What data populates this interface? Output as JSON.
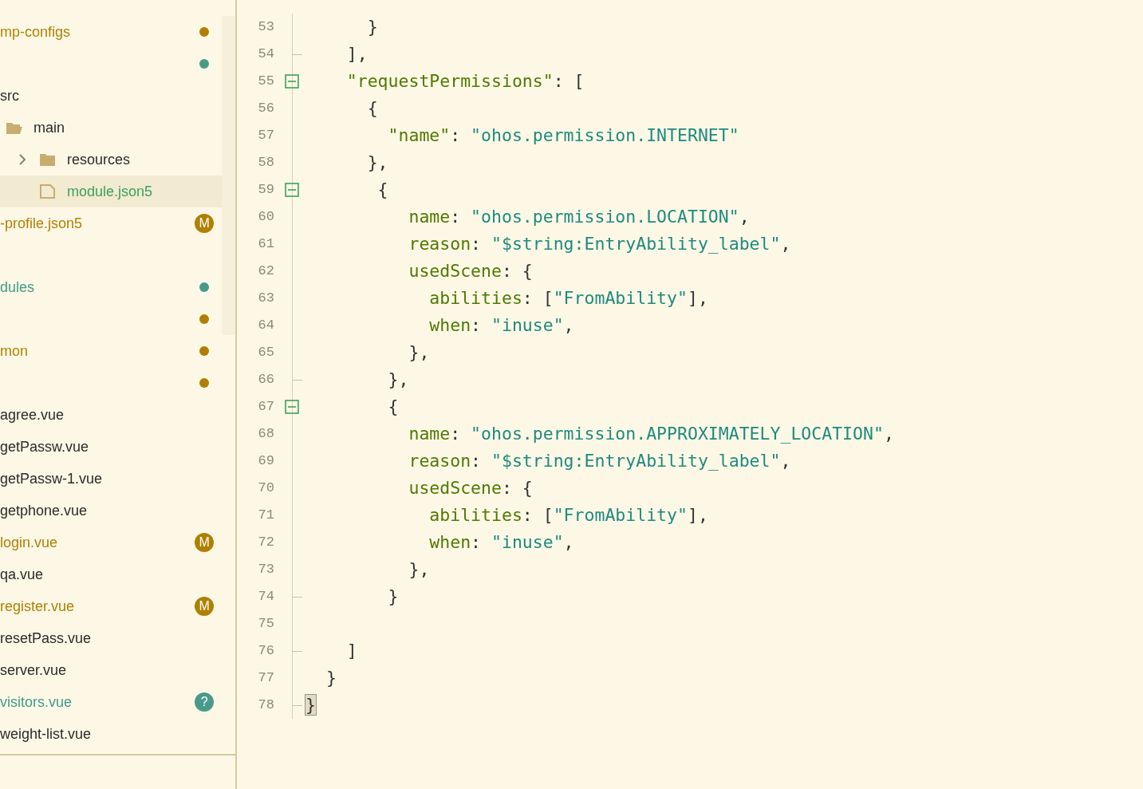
{
  "sidebar": {
    "items": [
      {
        "kind": "plain",
        "text": "mp-configs",
        "color": "#b07f00",
        "decoration": {
          "kind": "dot",
          "color": "#b07f00"
        }
      },
      {
        "kind": "plain",
        "decoration": {
          "kind": "dot",
          "color": "#4a9a8c"
        }
      },
      {
        "kind": "plain",
        "text": "src",
        "color": "#2b2b2b"
      },
      {
        "kind": "folder_open",
        "text": "main",
        "color": "#2b2b2b"
      },
      {
        "kind": "folder",
        "text": "resources",
        "color": "#2b2b2b",
        "expanded": false
      },
      {
        "kind": "file",
        "text": "module.json5",
        "color": "#3aa35a",
        "selected": true
      },
      {
        "kind": "plain",
        "text": "-profile.json5",
        "color": "#b07f00",
        "selected": false,
        "decoration": {
          "kind": "badge",
          "text": "M",
          "color": "#b07f00"
        }
      },
      {
        "kind": "spacer"
      },
      {
        "kind": "plain",
        "text": "dules",
        "color": "#3f9a8c",
        "decoration": {
          "kind": "dot",
          "color": "#4a9a8c"
        }
      },
      {
        "kind": "plain",
        "decoration": {
          "kind": "dot",
          "color": "#b07f00"
        }
      },
      {
        "kind": "plain",
        "text": "mon",
        "color": "#b07f00",
        "decoration": {
          "kind": "dot",
          "color": "#b07f00"
        }
      },
      {
        "kind": "plain",
        "decoration": {
          "kind": "dot",
          "color": "#b07f00"
        }
      },
      {
        "kind": "plain",
        "text": "agree.vue",
        "color": "#2b2b2b"
      },
      {
        "kind": "plain",
        "text": "getPassw.vue",
        "color": "#2b2b2b"
      },
      {
        "kind": "plain",
        "text": "getPassw-1.vue",
        "color": "#2b2b2b"
      },
      {
        "kind": "plain",
        "text": "getphone.vue",
        "color": "#2b2b2b"
      },
      {
        "kind": "plain",
        "text": "login.vue",
        "color": "#b07f00",
        "decoration": {
          "kind": "badge",
          "text": "M",
          "color": "#b07f00"
        }
      },
      {
        "kind": "plain",
        "text": "qa.vue",
        "color": "#2b2b2b"
      },
      {
        "kind": "plain",
        "text": "register.vue",
        "color": "#b07f00",
        "decoration": {
          "kind": "badge",
          "text": "M",
          "color": "#b07f00"
        }
      },
      {
        "kind": "plain",
        "text": "resetPass.vue",
        "color": "#2b2b2b"
      },
      {
        "kind": "plain",
        "text": "server.vue",
        "color": "#2b2b2b"
      },
      {
        "kind": "plain",
        "text": "visitors.vue",
        "color": "#3f9a8c",
        "decoration": {
          "kind": "badge",
          "text": "?",
          "color": "#4a9a8c"
        }
      },
      {
        "kind": "plain",
        "text": "weight-list.vue",
        "color": "#2b2b2b"
      }
    ]
  },
  "editor": {
    "lines": [
      {
        "number": "53",
        "fold_toggle": false,
        "fold_end": false,
        "tokens": [
          {
            "kind": "punct",
            "text": "      }"
          }
        ]
      },
      {
        "number": "54",
        "fold_toggle": false,
        "fold_end": true,
        "tokens": [
          {
            "kind": "punct",
            "text": "    ],"
          }
        ]
      },
      {
        "number": "55",
        "fold_toggle": true,
        "fold_end": false,
        "tokens": [
          {
            "kind": "key",
            "text": "    \"requestPermissions\""
          },
          {
            "kind": "punct",
            "text": ": ["
          }
        ]
      },
      {
        "number": "56",
        "fold_toggle": false,
        "fold_end": false,
        "tokens": [
          {
            "kind": "punct",
            "text": "      {"
          }
        ]
      },
      {
        "number": "57",
        "fold_toggle": false,
        "fold_end": false,
        "tokens": [
          {
            "kind": "key",
            "text": "        \"name\""
          },
          {
            "kind": "punct",
            "text": ": "
          },
          {
            "kind": "str",
            "text": "\"ohos.permission.INTERNET\""
          }
        ]
      },
      {
        "number": "58",
        "fold_toggle": false,
        "fold_end": false,
        "tokens": [
          {
            "kind": "punct",
            "text": "      },"
          }
        ]
      },
      {
        "number": "59",
        "fold_toggle": true,
        "fold_end": false,
        "tokens": [
          {
            "kind": "punct",
            "text": "       {"
          }
        ]
      },
      {
        "number": "60",
        "fold_toggle": false,
        "fold_end": false,
        "tokens": [
          {
            "kind": "key",
            "text": "          name"
          },
          {
            "kind": "punct",
            "text": ": "
          },
          {
            "kind": "str",
            "text": "\"ohos.permission.LOCATION\""
          },
          {
            "kind": "punct",
            "text": ","
          }
        ]
      },
      {
        "number": "61",
        "fold_toggle": false,
        "fold_end": false,
        "tokens": [
          {
            "kind": "key",
            "text": "          reason"
          },
          {
            "kind": "punct",
            "text": ": "
          },
          {
            "kind": "str",
            "text": "\"$string:EntryAbility_label\""
          },
          {
            "kind": "punct",
            "text": ","
          }
        ]
      },
      {
        "number": "62",
        "fold_toggle": false,
        "fold_end": false,
        "tokens": [
          {
            "kind": "key",
            "text": "          usedScene"
          },
          {
            "kind": "punct",
            "text": ": {"
          }
        ]
      },
      {
        "number": "63",
        "fold_toggle": false,
        "fold_end": false,
        "tokens": [
          {
            "kind": "key",
            "text": "            abilities"
          },
          {
            "kind": "punct",
            "text": ": ["
          },
          {
            "kind": "str",
            "text": "\"FromAbility\""
          },
          {
            "kind": "punct",
            "text": "],"
          }
        ]
      },
      {
        "number": "64",
        "fold_toggle": false,
        "fold_end": false,
        "tokens": [
          {
            "kind": "key",
            "text": "            when"
          },
          {
            "kind": "punct",
            "text": ": "
          },
          {
            "kind": "str",
            "text": "\"inuse\""
          },
          {
            "kind": "punct",
            "text": ","
          }
        ]
      },
      {
        "number": "65",
        "fold_toggle": false,
        "fold_end": false,
        "tokens": [
          {
            "kind": "punct",
            "text": "          },"
          }
        ]
      },
      {
        "number": "66",
        "fold_toggle": false,
        "fold_end": true,
        "tokens": [
          {
            "kind": "punct",
            "text": "        },"
          }
        ]
      },
      {
        "number": "67",
        "fold_toggle": true,
        "fold_end": false,
        "tokens": [
          {
            "kind": "punct",
            "text": "        {"
          }
        ]
      },
      {
        "number": "68",
        "fold_toggle": false,
        "fold_end": false,
        "tokens": [
          {
            "kind": "key",
            "text": "          name"
          },
          {
            "kind": "punct",
            "text": ": "
          },
          {
            "kind": "str",
            "text": "\"ohos.permission.APPROXIMATELY_LOCATION\""
          },
          {
            "kind": "punct",
            "text": ","
          }
        ]
      },
      {
        "number": "69",
        "fold_toggle": false,
        "fold_end": false,
        "tokens": [
          {
            "kind": "key",
            "text": "          reason"
          },
          {
            "kind": "punct",
            "text": ": "
          },
          {
            "kind": "str",
            "text": "\"$string:EntryAbility_label\""
          },
          {
            "kind": "punct",
            "text": ","
          }
        ]
      },
      {
        "number": "70",
        "fold_toggle": false,
        "fold_end": false,
        "tokens": [
          {
            "kind": "key",
            "text": "          usedScene"
          },
          {
            "kind": "punct",
            "text": ": {"
          }
        ]
      },
      {
        "number": "71",
        "fold_toggle": false,
        "fold_end": false,
        "tokens": [
          {
            "kind": "key",
            "text": "            abilities"
          },
          {
            "kind": "punct",
            "text": ": ["
          },
          {
            "kind": "str",
            "text": "\"FromAbility\""
          },
          {
            "kind": "punct",
            "text": "],"
          }
        ]
      },
      {
        "number": "72",
        "fold_toggle": false,
        "fold_end": false,
        "tokens": [
          {
            "kind": "key",
            "text": "            when"
          },
          {
            "kind": "punct",
            "text": ": "
          },
          {
            "kind": "str",
            "text": "\"inuse\""
          },
          {
            "kind": "punct",
            "text": ","
          }
        ]
      },
      {
        "number": "73",
        "fold_toggle": false,
        "fold_end": false,
        "tokens": [
          {
            "kind": "punct",
            "text": "          },"
          }
        ]
      },
      {
        "number": "74",
        "fold_toggle": false,
        "fold_end": true,
        "tokens": [
          {
            "kind": "punct",
            "text": "        }"
          }
        ]
      },
      {
        "number": "75",
        "fold_toggle": false,
        "fold_end": false
      },
      {
        "number": "76",
        "fold_toggle": false,
        "fold_end": true,
        "tokens": [
          {
            "kind": "punct",
            "text": "    ]"
          }
        ]
      },
      {
        "number": "77",
        "fold_toggle": false,
        "fold_end": false,
        "tokens": [
          {
            "kind": "punct",
            "text": "  }"
          }
        ]
      },
      {
        "number": "78",
        "fold_toggle": false,
        "fold_end": true,
        "tokens": [
          {
            "kind": "match",
            "text": "}"
          }
        ]
      }
    ]
  }
}
